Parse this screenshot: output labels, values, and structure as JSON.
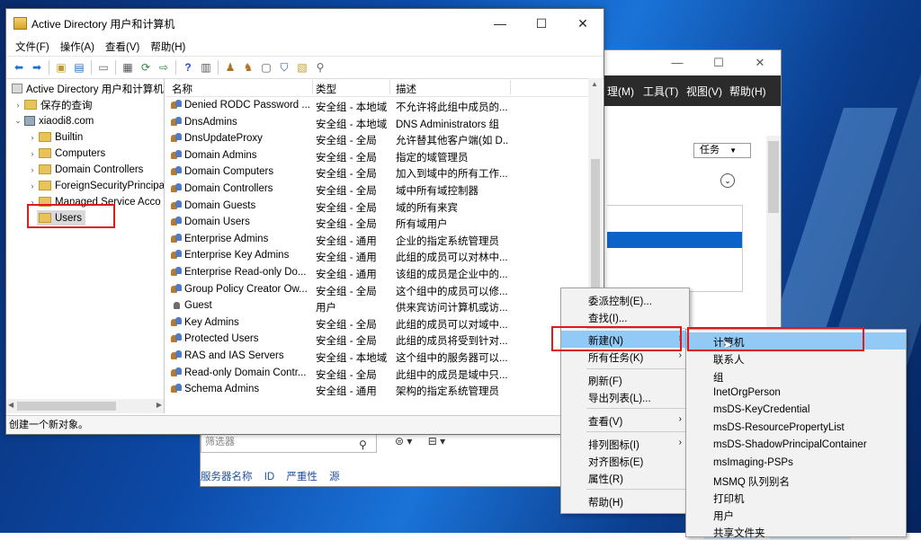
{
  "background_window": {
    "menu": [
      "理(M)",
      "工具(T)",
      "视图(V)",
      "帮助(H)"
    ],
    "tasks_label": "任务",
    "filter_placeholder": "筛选器",
    "bottom_cols": [
      "服务器名称",
      "ID",
      "严重性",
      "源"
    ]
  },
  "window": {
    "title": "Active Directory 用户和计算机",
    "menu": [
      "文件(F)",
      "操作(A)",
      "查看(V)",
      "帮助(H)"
    ]
  },
  "tree": {
    "root": "Active Directory 用户和计算机",
    "saved_queries": "保存的查询",
    "domain": "xiaodi8.com",
    "children": [
      "Builtin",
      "Computers",
      "Domain Controllers",
      "ForeignSecurityPrincipa",
      "Managed Service Acco",
      "Users"
    ]
  },
  "list": {
    "headers": [
      "名称",
      "类型",
      "描述"
    ],
    "rows": [
      [
        "Denied RODC Password ...",
        "安全组 - 本地域",
        "不允许将此组中成员的..."
      ],
      [
        "DnsAdmins",
        "安全组 - 本地域",
        "DNS Administrators 组"
      ],
      [
        "DnsUpdateProxy",
        "安全组 - 全局",
        "允许替其他客户端(如 D..."
      ],
      [
        "Domain Admins",
        "安全组 - 全局",
        "指定的域管理员"
      ],
      [
        "Domain Computers",
        "安全组 - 全局",
        "加入到域中的所有工作..."
      ],
      [
        "Domain Controllers",
        "安全组 - 全局",
        "域中所有域控制器"
      ],
      [
        "Domain Guests",
        "安全组 - 全局",
        "域的所有来宾"
      ],
      [
        "Domain Users",
        "安全组 - 全局",
        "所有域用户"
      ],
      [
        "Enterprise Admins",
        "安全组 - 通用",
        "企业的指定系统管理员"
      ],
      [
        "Enterprise Key Admins",
        "安全组 - 通用",
        "此组的成员可以对林中..."
      ],
      [
        "Enterprise Read-only Do...",
        "安全组 - 通用",
        "该组的成员是企业中的..."
      ],
      [
        "Group Policy Creator Ow...",
        "安全组 - 全局",
        "这个组中的成员可以修..."
      ],
      [
        "Guest",
        "用户",
        "供来宾访问计算机或访..."
      ],
      [
        "Key Admins",
        "安全组 - 全局",
        "此组的成员可以对域中..."
      ],
      [
        "Protected Users",
        "安全组 - 全局",
        "此组的成员将受到针对..."
      ],
      [
        "RAS and IAS Servers",
        "安全组 - 本地域",
        "这个组中的服务器可以..."
      ],
      [
        "Read-only Domain Contr...",
        "安全组 - 全局",
        "此组中的成员是域中只..."
      ],
      [
        "Schema Admins",
        "安全组 - 通用",
        "架构的指定系统管理员"
      ]
    ]
  },
  "status": "创建一个新对象。",
  "context_menu": [
    "委派控制(E)...",
    "查找(I)...",
    "新建(N)",
    "所有任务(K)",
    "刷新(F)",
    "导出列表(L)...",
    "查看(V)",
    "排列图标(I)",
    "对齐图标(E)",
    "属性(R)",
    "帮助(H)"
  ],
  "submenu": [
    "计算机",
    "联系人",
    "组",
    "InetOrgPerson",
    "msDS-KeyCredential",
    "msDS-ResourcePropertyList",
    "msDS-ShadowPrincipalContainer",
    "msImaging-PSPs",
    "MSMQ 队列别名",
    "打印机",
    "用户",
    "共享文件夹"
  ],
  "colors": {
    "highlight_red": "#e01a1a",
    "menu_select": "#91c9f7",
    "folder": "#e8c35c"
  }
}
